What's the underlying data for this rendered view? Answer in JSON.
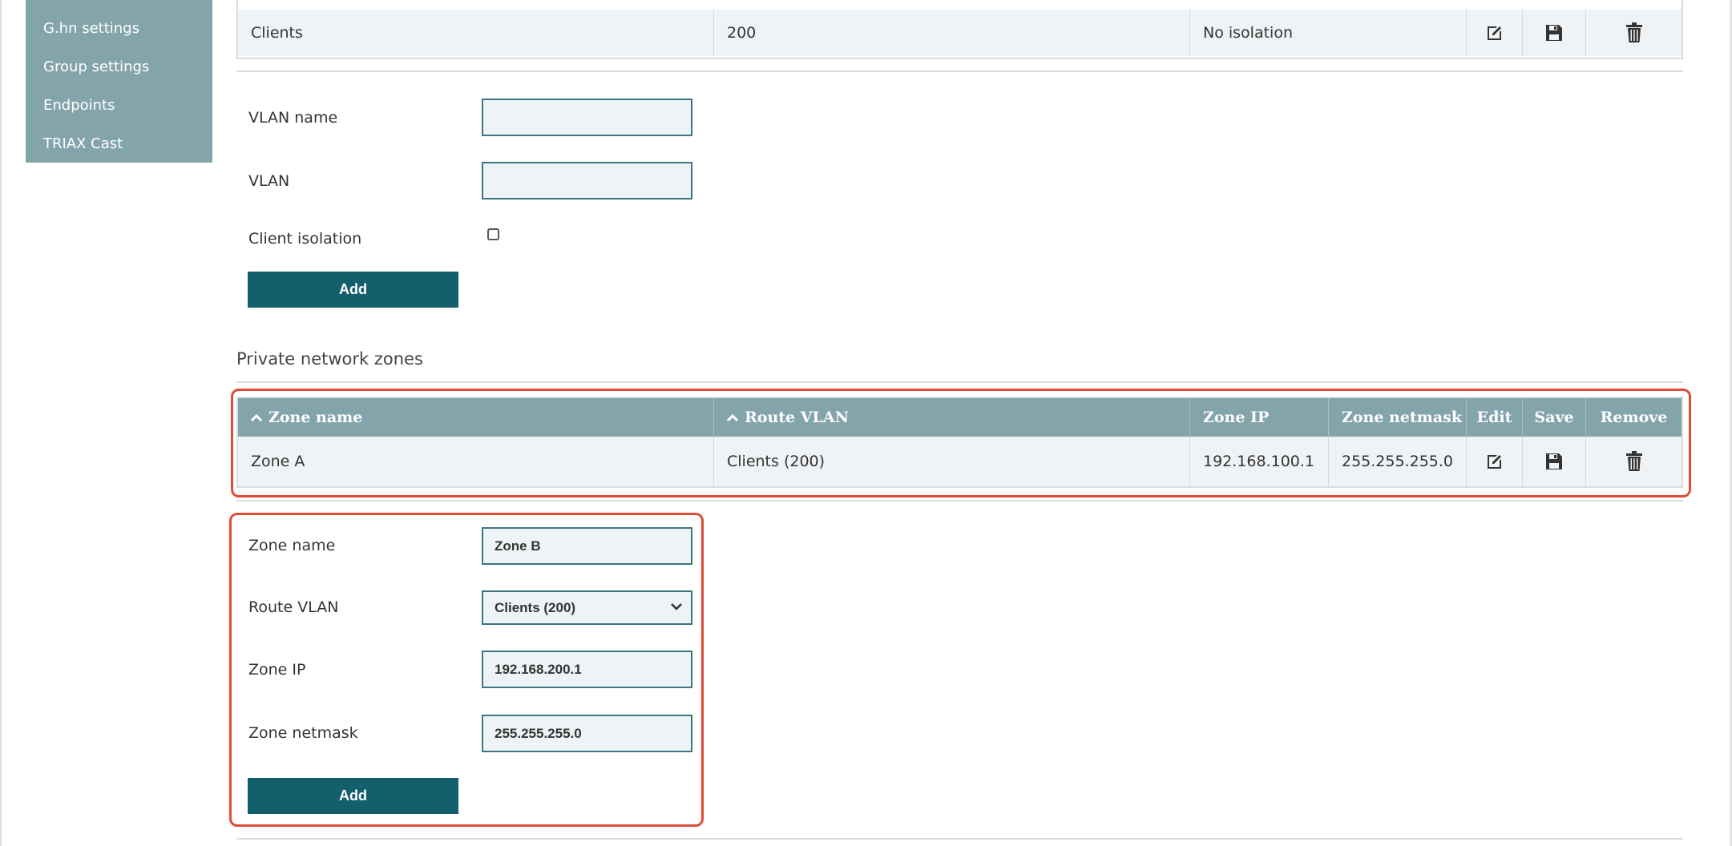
{
  "sidebar": {
    "items": [
      {
        "label": "G.hn settings"
      },
      {
        "label": "Group settings"
      },
      {
        "label": "Endpoints"
      },
      {
        "label": "TRIAX Cast"
      }
    ]
  },
  "vlan_table": {
    "rows": [
      {
        "name": "Clients",
        "vlan": "200",
        "isolation": "No isolation"
      }
    ]
  },
  "vlan_form": {
    "name_label": "VLAN name",
    "name_value": "",
    "vlan_label": "VLAN",
    "vlan_value": "",
    "isolation_label": "Client isolation",
    "isolation_checked": false,
    "add_label": "Add"
  },
  "zones": {
    "section_title": "Private network zones",
    "headers": {
      "zone_name": "Zone name",
      "route_vlan": "Route VLAN",
      "zone_ip": "Zone IP",
      "zone_netmask": "Zone netmask",
      "edit": "Edit",
      "save": "Save",
      "remove": "Remove"
    },
    "sort_icon": "chevron-up-icon",
    "rows": [
      {
        "zone_name": "Zone A",
        "route_vlan": "Clients (200)",
        "zone_ip": "192.168.100.1",
        "zone_netmask": "255.255.255.0"
      }
    ]
  },
  "zone_form": {
    "zone_name_label": "Zone name",
    "zone_name_value": "Zone B",
    "route_vlan_label": "Route VLAN",
    "route_vlan_value": "Clients (200)",
    "zone_ip_label": "Zone IP",
    "zone_ip_value": "192.168.200.1",
    "zone_netmask_label": "Zone netmask",
    "zone_netmask_value": "255.255.255.0",
    "add_label": "Add"
  },
  "icons": {
    "edit": "edit-icon",
    "save": "floppy-disk-icon",
    "remove": "trash-icon"
  },
  "colors": {
    "sidebar": "#84a4ab",
    "table_header": "#84a4ab",
    "button": "#135f6b",
    "highlight": "#e24b36",
    "input_border": "#3d7580"
  }
}
